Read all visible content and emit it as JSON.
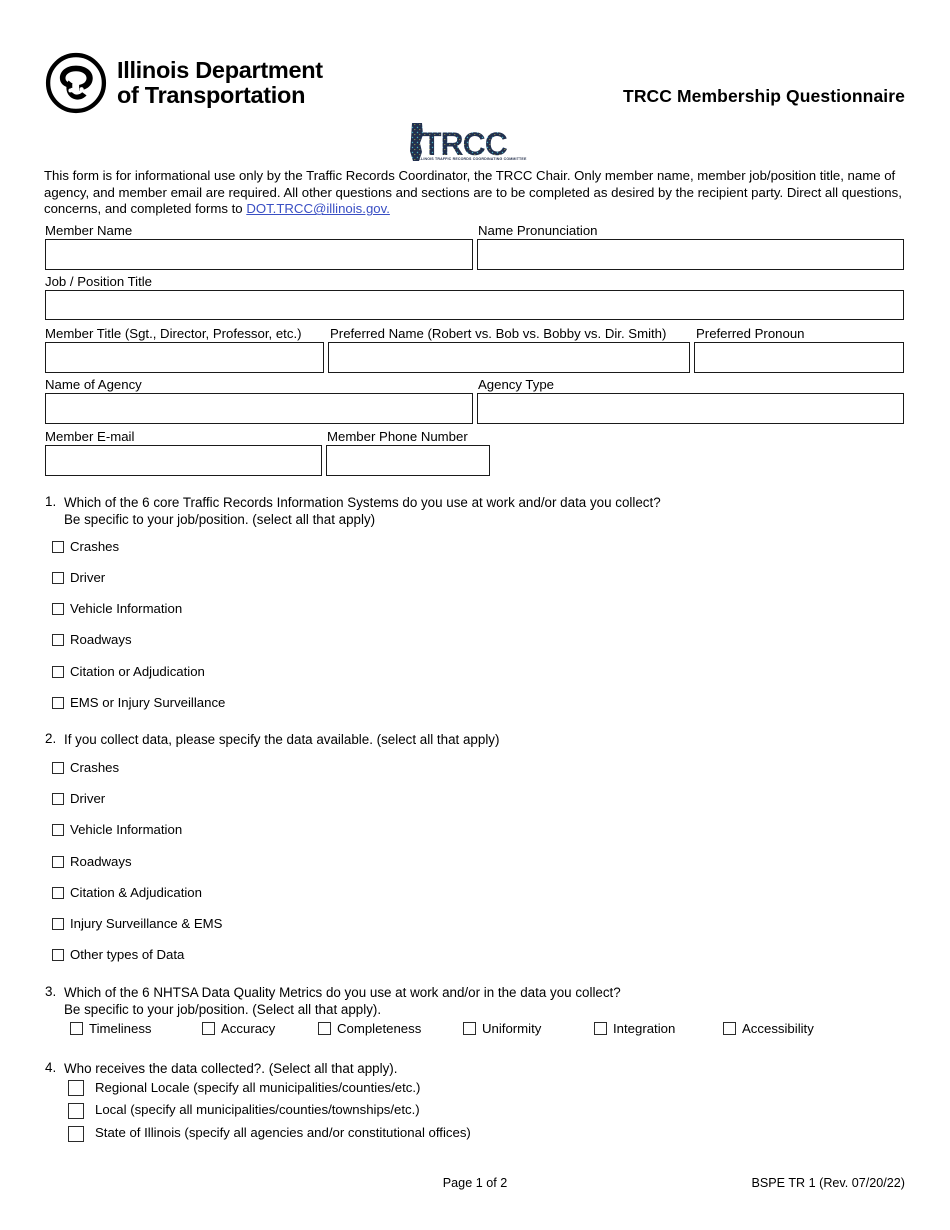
{
  "header": {
    "agency_line1": "Illinois Department",
    "agency_line2": "of Transportation",
    "form_title": "TRCC Membership Questionnaire",
    "trcc_logo_text": "TRCC",
    "trcc_tagline": "ILLINOIS TRAFFIC RECORDS COORDINATING COMMITTEE"
  },
  "intro": {
    "part1": "This form is for informational use only by the Traffic Records Coordinator, the TRCC Chair.  Only member name, member job/position title, name of agency, and member email are required.  All other questions and sections are to be completed as desired by the recipient party. Direct all questions, concerns, and completed forms to ",
    "email": "DOT.TRCC@illinois.gov."
  },
  "fields": {
    "member_name": {
      "label": "Member Name",
      "value": ""
    },
    "name_pronunciation": {
      "label": "Name Pronunciation",
      "value": ""
    },
    "job_position_title": {
      "label": "Job / Position Title",
      "value": ""
    },
    "member_title": {
      "label": "Member Title (Sgt., Director, Professor, etc.)",
      "value": ""
    },
    "preferred_name": {
      "label": "Preferred Name (Robert vs. Bob vs. Bobby vs. Dir. Smith)",
      "value": ""
    },
    "preferred_pronoun": {
      "label": "Preferred Pronoun",
      "value": ""
    },
    "name_of_agency": {
      "label": "Name of Agency",
      "value": ""
    },
    "agency_type": {
      "label": "Agency Type",
      "value": ""
    },
    "member_email": {
      "label": "Member E-mail",
      "value": ""
    },
    "member_phone": {
      "label": "Member Phone Number",
      "value": ""
    }
  },
  "questions": [
    {
      "number": "1.",
      "line1": "Which of the 6 core Traffic Records Information Systems do you use at work and/or data you collect?",
      "line2": "Be specific to your job/position. (select all that apply)",
      "options": [
        "Crashes",
        "Driver",
        "Vehicle Information",
        "Roadways",
        "Citation or Adjudication",
        "EMS or Injury Surveillance"
      ]
    },
    {
      "number": "2.",
      "line1": "If you collect data, please specify the data available. (select all that apply)",
      "line2": "",
      "options": [
        "Crashes",
        "Driver",
        "Vehicle Information",
        "Roadways",
        "Citation & Adjudication",
        "Injury Surveillance & EMS",
        "Other types of Data"
      ]
    },
    {
      "number": "3.",
      "line1": "Which of the 6 NHTSA Data Quality Metrics do you use at work and/or in the data you collect?",
      "line2": "Be specific to your job/position. (Select all that apply).",
      "options": [
        "Timeliness",
        "Accuracy",
        "Completeness",
        "Uniformity",
        "Integration",
        "Accessibility"
      ]
    },
    {
      "number": "4.",
      "line1": "Who receives the data collected?. (Select all that apply).",
      "line2": "",
      "options": [
        "Regional Locale (specify all municipalities/counties/etc.)",
        "Local (specify all municipalities/counties/townships/etc.)",
        "State of Illinois (specify all agencies and/or constitutional offices)"
      ]
    }
  ],
  "footer": {
    "page": "Page 1 of 2",
    "form_code": "BSPE TR 1 (Rev. 07/20/22)"
  },
  "colors": {
    "link": "#3a4fc4",
    "trcc_navy": "#22304f",
    "border": "#1a1a1a"
  }
}
